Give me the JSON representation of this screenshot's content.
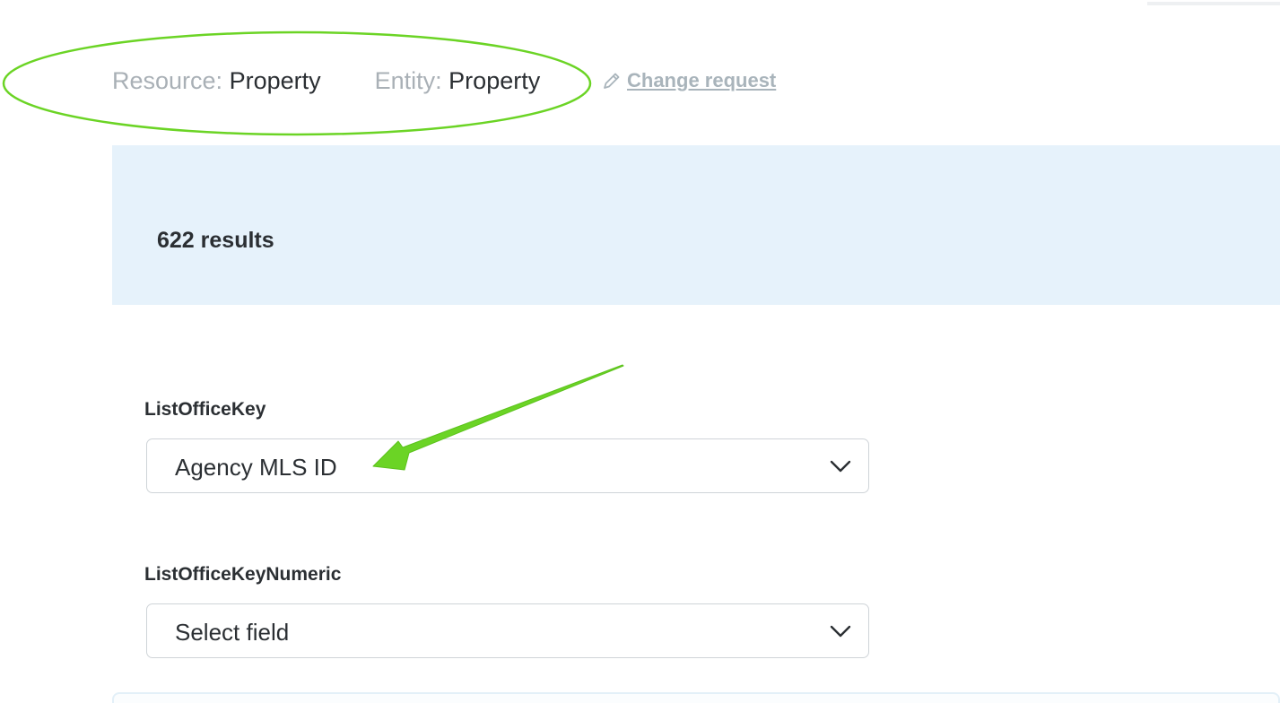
{
  "header": {
    "resource_label": "Resource:",
    "resource_value": "Property",
    "entity_label": "Entity:",
    "entity_value": "Property",
    "change_request": "Change request",
    "change_request_icon": "pencil-icon"
  },
  "results": {
    "count_text": "622 results"
  },
  "fields": [
    {
      "label": "ListOfficeKey",
      "selected": "Agency MLS ID",
      "icon": "chevron-down-icon"
    },
    {
      "label": "ListOfficeKeyNumeric",
      "selected": "Select field",
      "icon": "chevron-down-icon"
    }
  ],
  "colors": {
    "annotation": "#6bd425",
    "panel_background": "#e6f2fb",
    "muted_text": "#a9b0b6",
    "link": "#a9b4bb",
    "text": "#2b2f33",
    "border": "#cfd4d8"
  }
}
